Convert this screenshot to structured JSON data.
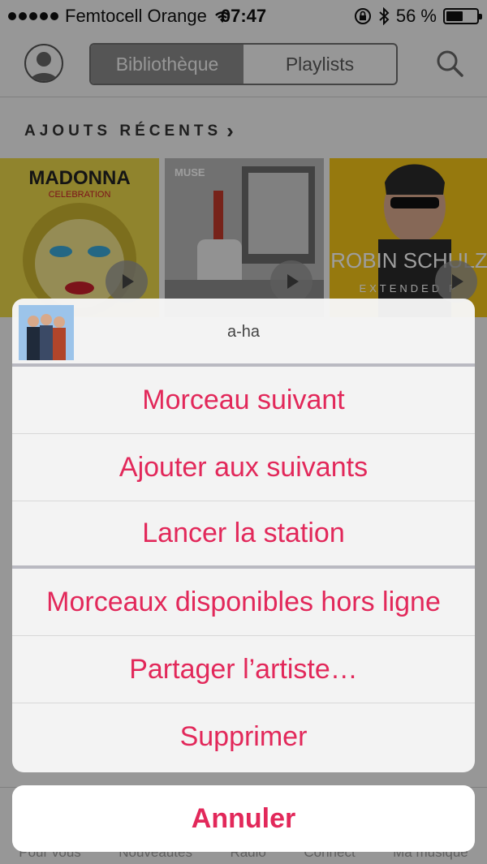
{
  "status_bar": {
    "carrier": "Femtocell Orange",
    "time": "07:47",
    "battery_percent_label": "56 %",
    "battery_level": 0.56
  },
  "navbar": {
    "segments": [
      "Bibliothèque",
      "Playlists"
    ],
    "active_segment": "Bibliothèque"
  },
  "section": {
    "title": "AJOUTS RÉCENTS",
    "chevron": "›"
  },
  "albums": [
    {
      "artwork_title": "MADONNA",
      "artwork_subtitle": "CELEBRATION",
      "colors": [
        "#e8d43a",
        "#2b2b2b"
      ]
    },
    {
      "artwork_title": "MUSE",
      "artwork_subtitle": "",
      "colors": [
        "#bdbdbd",
        "#3a3a3a"
      ]
    },
    {
      "artwork_title": "ROBIN SCHULZ",
      "artwork_subtitle": "EXTENDED P",
      "colors": [
        "#f2c318",
        "#1d1d1d"
      ]
    }
  ],
  "action_sheet": {
    "artist": "a-ha",
    "items": [
      "Morceau suivant",
      "Ajouter aux suivants",
      "Lancer la station",
      "Morceaux disponibles hors ligne",
      "Partager l’artiste…",
      "Supprimer"
    ],
    "cancel_label": "Annuler"
  },
  "tab_bar": {
    "items": [
      "Pour vous",
      "Nouveautés",
      "Radio",
      "Connect",
      "Ma musique"
    ]
  },
  "colors": {
    "accent": "#e2285a",
    "segment_active": "#8a8a8a"
  }
}
